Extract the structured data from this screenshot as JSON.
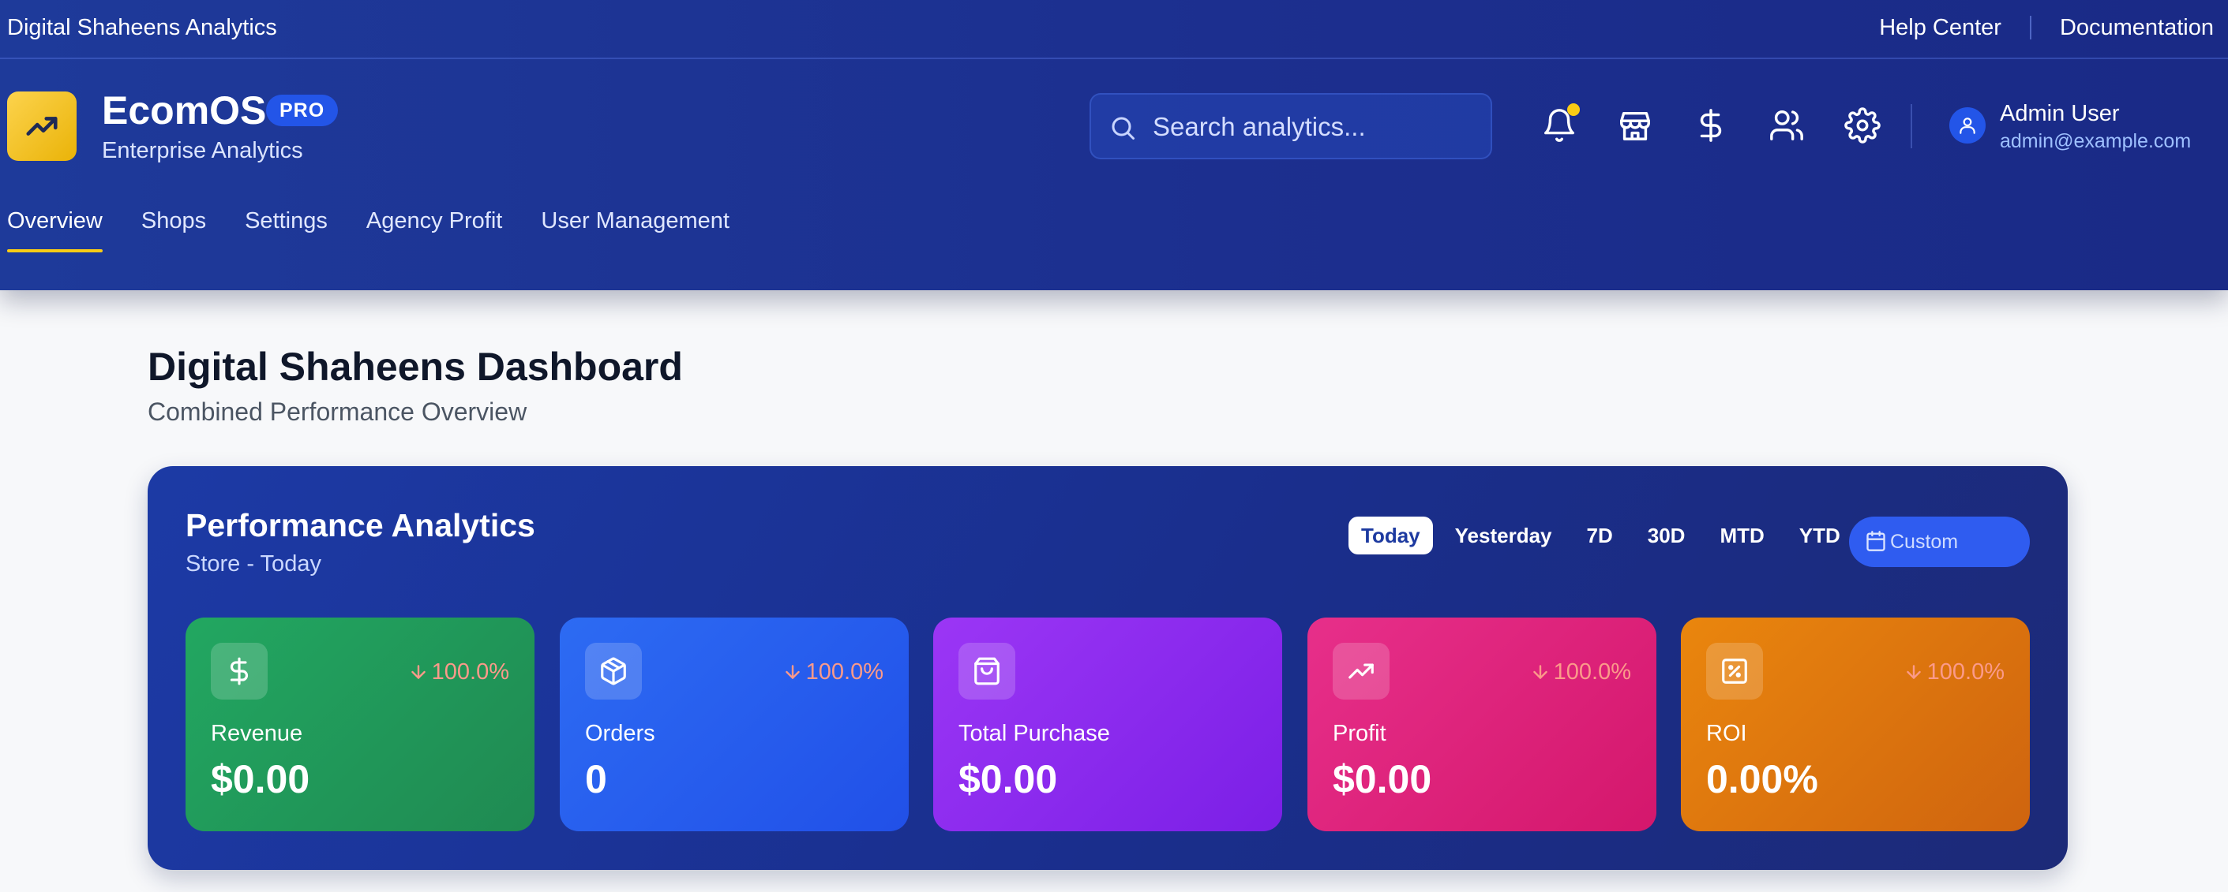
{
  "topbar": {
    "brand_name": "Digital Shaheens Analytics",
    "help_center": "Help Center",
    "documentation": "Documentation"
  },
  "app": {
    "name": "EcomOS",
    "badge": "PRO",
    "subtitle": "Enterprise Analytics"
  },
  "search": {
    "placeholder": "Search analytics...",
    "value": ""
  },
  "header_icons": [
    "bell-icon",
    "store-icon",
    "dollar-icon",
    "users-icon",
    "gear-icon"
  ],
  "user": {
    "name": "Admin User",
    "email": "admin@example.com"
  },
  "nav": {
    "tabs": [
      {
        "label": "Overview",
        "active": true
      },
      {
        "label": "Shops",
        "active": false
      },
      {
        "label": "Settings",
        "active": false
      },
      {
        "label": "Agency Profit",
        "active": false
      },
      {
        "label": "User Management",
        "active": false
      }
    ]
  },
  "page": {
    "title": "Digital Shaheens Dashboard",
    "subtitle": "Combined Performance Overview"
  },
  "performance": {
    "title": "Performance Analytics",
    "subtitle": "Store - Today",
    "ranges": [
      {
        "label": "Today",
        "active": true
      },
      {
        "label": "Yesterday",
        "active": false
      },
      {
        "label": "7D",
        "active": false
      },
      {
        "label": "30D",
        "active": false
      },
      {
        "label": "MTD",
        "active": false
      },
      {
        "label": "YTD",
        "active": false
      }
    ],
    "custom_label": "Custom",
    "metrics": [
      {
        "label": "Revenue",
        "value": "$0.00",
        "change": "100.0%",
        "icon": "dollar-icon",
        "color": "#22a761"
      },
      {
        "label": "Orders",
        "value": "0",
        "change": "100.0%",
        "icon": "box-icon",
        "color": "#2d6bf3"
      },
      {
        "label": "Total Purchase",
        "value": "$0.00",
        "change": "",
        "icon": "shopping-bag-icon",
        "color": "#9b36f5"
      },
      {
        "label": "Profit",
        "value": "$0.00",
        "change": "100.0%",
        "icon": "trending-up-icon",
        "color": "#e72f8a"
      },
      {
        "label": "ROI",
        "value": "0.00%",
        "change": "100.0%",
        "icon": "percent-icon",
        "color": "#ea860d"
      }
    ]
  },
  "colors": {
    "header_bg": "#1e3a9a",
    "accent_yellow": "#facc15",
    "change_negative": "#fb9a8a",
    "page_bg": "#f7f8fa"
  }
}
